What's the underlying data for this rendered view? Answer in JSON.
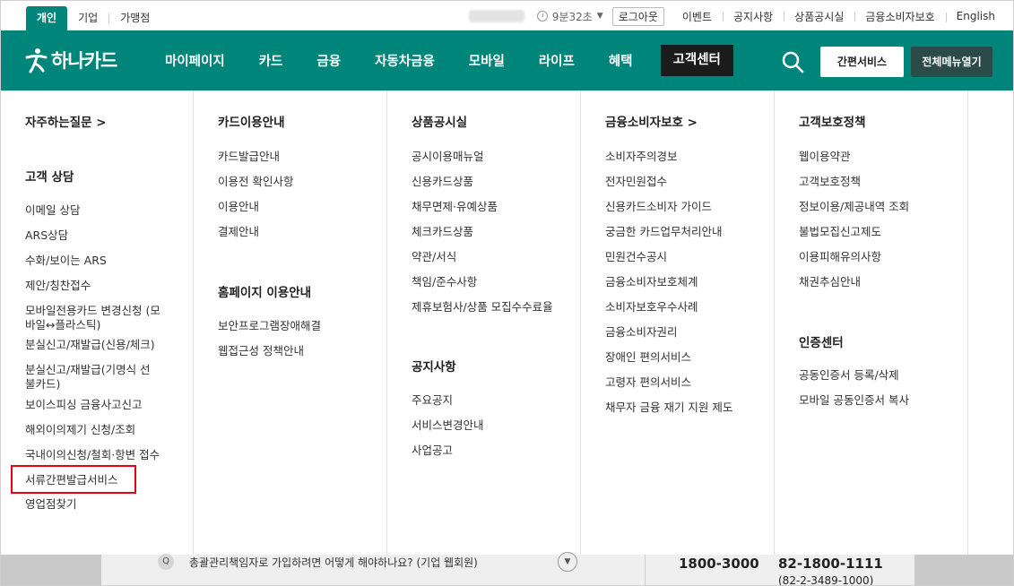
{
  "utility": {
    "tabs": [
      "개인",
      "기업",
      "가맹점"
    ],
    "timer": "9분32초",
    "logout": "로그아웃",
    "links": [
      "이벤트",
      "공지사항",
      "상품공시실",
      "금융소비자보호",
      "English"
    ]
  },
  "gnb": {
    "logo": "하나카드",
    "menu": [
      "마이페이지",
      "카드",
      "금융",
      "자동차금융",
      "모바일",
      "라이프",
      "혜택",
      "고객센터"
    ],
    "easy_service": "간편서비스",
    "all_menu": "전체메뉴열기"
  },
  "mega": {
    "col1": {
      "faq": "자주하는질문 >",
      "counsel_title": "고객 상담",
      "items": [
        "이메일 상담",
        "ARS상담",
        "수화/보이는 ARS",
        "제안/칭찬접수",
        "모바일전용카드 변경신청 (모바일↔플라스틱)",
        "분실신고/재발급(신용/체크)",
        "분실신고/재발급(기명식 선불카드)",
        "보이스피싱 금융사고신고",
        "해외이의제기 신청/조회",
        "국내이의신청/철회·항변 접수",
        "서류간편발급서비스",
        "영업점찾기"
      ]
    },
    "col2": {
      "title1": "카드이용안내",
      "items1": [
        "카드발급안내",
        "이용전 확인사항",
        "이용안내",
        "결제안내"
      ],
      "title2": "홈페이지 이용안내",
      "items2": [
        "보안프로그램장애해결",
        "웹접근성 정책안내"
      ]
    },
    "col3": {
      "title1": "상품공시실",
      "items1": [
        "공시이용매뉴얼",
        "신용카드상품",
        "채무면제·유예상품",
        "체크카드상품",
        "약관/서식",
        "책임/준수사항",
        "제휴보험사/상품 모집수수료율"
      ],
      "title2": "공지사항",
      "items2": [
        "주요공지",
        "서비스변경안내",
        "사업공고"
      ]
    },
    "col4": {
      "title1": "금융소비자보호 >",
      "items1": [
        "소비자주의경보",
        "전자민원접수",
        "신용카드소비자 가이드",
        "궁금한 카드업무처리안내",
        "민원건수공시",
        "금융소비자보호체계",
        "소비자보호우수사례",
        "금융소비자권리",
        "장애인 편의서비스",
        "고령자 편의서비스",
        "채무자 금융 재기 지원 제도"
      ]
    },
    "col5": {
      "title1": "고객보호정책",
      "items1": [
        "웹이용약관",
        "고객보호정책",
        "정보이용/제공내역 조회",
        "불법모집신고제도",
        "이용피해유의사항",
        "채권추심안내"
      ],
      "title2": "인증센터",
      "items2": [
        "공동인증서 등록/삭제",
        "모바일 공동인증서 복사"
      ]
    }
  },
  "bottom": {
    "q": "Q",
    "question": "총괄관리책임자로 가입하려면 어떻게 해야하나요? (기업 웹회원)",
    "tel1": "1800-3000",
    "tel2": "82-1800-1111",
    "tel3": "(82-2-3489-1000)"
  },
  "colors": {
    "brand": "#00857a",
    "dark": "#1b1b1b",
    "highlight": "#e60012"
  }
}
